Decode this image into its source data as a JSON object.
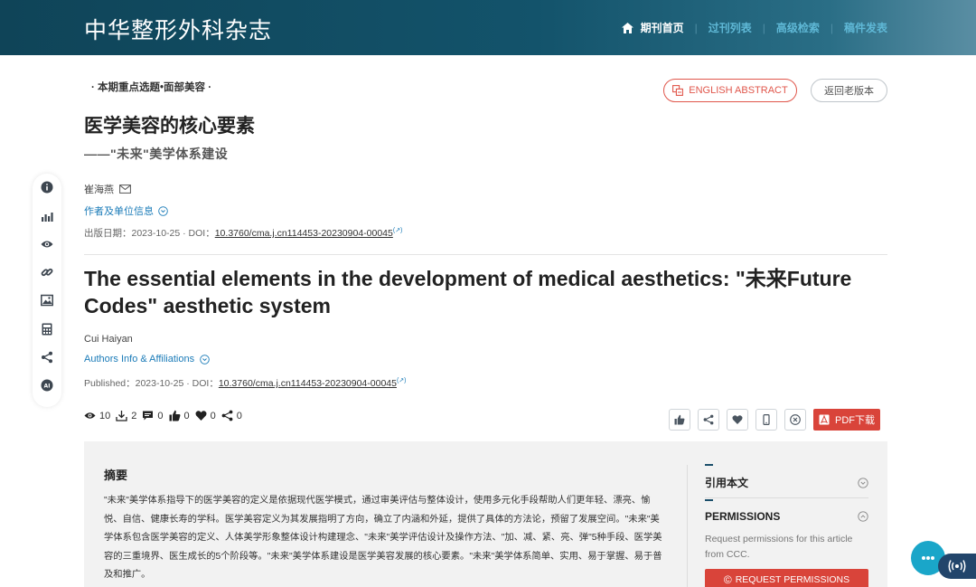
{
  "header": {
    "site_title": "中华整形外科杂志",
    "nav": [
      "期刊首页",
      "过刊列表",
      "高级检索",
      "稿件发表"
    ]
  },
  "article": {
    "column_tag": "· 本期重点选题•面部美容 ·",
    "english_abstract_label": "ENGLISH ABSTRACT",
    "old_version_label": "返回老版本",
    "zh_title": "医学美容的核心要素",
    "zh_subtitle": "——\"未来\"美学体系建设",
    "zh_author": "崔海燕",
    "zh_affil_label": "作者及单位信息",
    "zh_pub_prefix": "出版日期：2023-10-25 · DOI：",
    "doi": "10.3760/cma.j.cn114453-20230904-00045",
    "en_title": "The essential elements in the development of medical aesthetics: \"未来Future Codes\" aesthetic system",
    "en_author": "Cui Haiyan",
    "en_affil_label": "Authors Info & Affiliations",
    "en_pub_prefix": "Published：2023-10-25 · DOI：",
    "ext_mark": "(↗)"
  },
  "stats": {
    "views": "10",
    "downloads": "2",
    "comments": "0",
    "likes": "0",
    "favorites": "0",
    "shares": "0"
  },
  "actions": {
    "pdf_label": "PDF下载"
  },
  "abstract": {
    "title": "摘要",
    "text": "\"未来\"美学体系指导下的医学美容的定义是依据现代医学模式，通过审美评估与整体设计，使用多元化手段帮助人们更年轻、漂亮、愉悦、自信、健康长寿的学科。医学美容定义为其发展指明了方向，确立了内涵和外延，提供了具体的方法论，预留了发展空间。\"未来\"美学体系包含医学美容的定义、人体美学形象整体设计构建理念、\"未来\"美学评估设计及操作方法、\"加、减、紧、亮、弹\"5种手段、医学美容的三重境界、医生成长的5个阶段等。\"未来\"美学体系建设是医学美容发展的核心要素。\"未来\"美学体系简单、实用、易于掌握、易于普及和推广。"
  },
  "sidebar": {
    "cite_label": "引用本文",
    "permissions_label": "PERMISSIONS",
    "permissions_text": "Request permissions for this article from CCC.",
    "request_button": "REQUEST PERMISSIONS",
    "request_symbol": "©"
  },
  "colors": {
    "header_bg": "#13536b",
    "accent_red": "#d9443a",
    "link_blue": "#1a7bb8",
    "chat_cyan": "#1aa6c9"
  },
  "icons": {
    "toolrail": [
      "info-icon",
      "metrics-icon",
      "eye-icon",
      "link-icon",
      "image-icon",
      "calculator-icon",
      "share-icon",
      "ai-icon"
    ]
  }
}
